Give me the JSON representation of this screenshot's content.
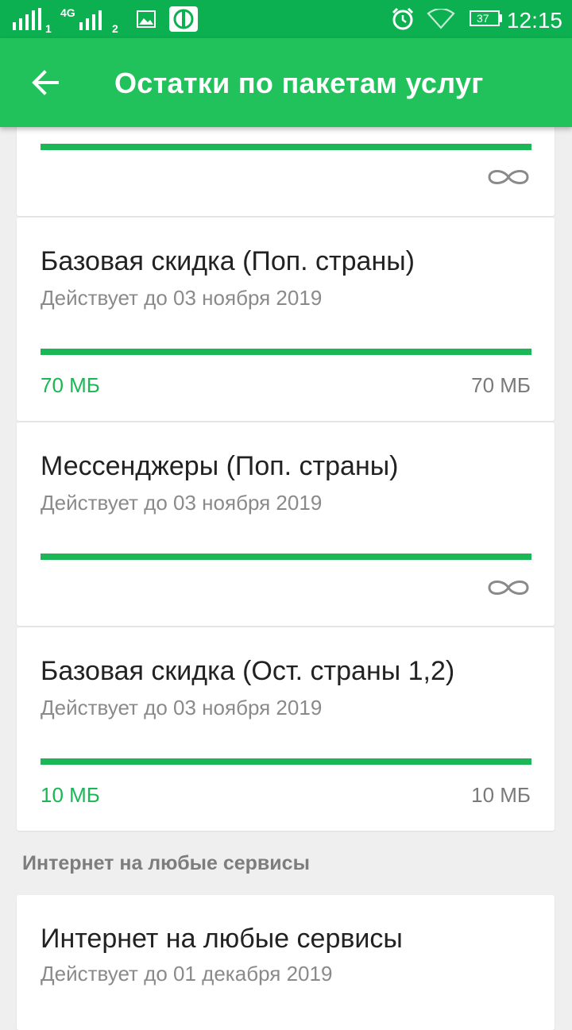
{
  "status_bar": {
    "sim1_label": "1",
    "sim2_network": "4G",
    "sim2_label": "2",
    "battery_level": "37",
    "time": "12:15",
    "icons": [
      "signal-icon",
      "signal-4g-icon",
      "gallery-icon",
      "operator-app-icon",
      "alarm-icon",
      "wifi-icon",
      "battery-icon"
    ]
  },
  "app_bar": {
    "back_icon": "arrow-left-icon",
    "title": "Остатки по пакетам услуг"
  },
  "packages": [
    {
      "title": "",
      "progress": 1.0,
      "limit": "unlimited"
    },
    {
      "title": "Базовая скидка (Поп. страны)",
      "valid_until": "Действует до 03 ноября 2019",
      "progress": 1.0,
      "remaining": "70 МБ",
      "total": "70 МБ"
    },
    {
      "title": "Мессенджеры (Поп. страны)",
      "valid_until": "Действует до 03 ноября 2019",
      "progress": 1.0,
      "limit": "unlimited"
    },
    {
      "title": "Базовая скидка (Ост. страны 1,2)",
      "valid_until": "Действует до 03 ноября 2019",
      "progress": 1.0,
      "remaining": "10 МБ",
      "total": "10 МБ"
    }
  ],
  "section": {
    "label": "Интернет на любые сервисы"
  },
  "section_packages": [
    {
      "title": "Интернет на любые сервисы",
      "valid_until": "Действует до 01 декабря 2019"
    }
  ],
  "colors": {
    "status_bar": "#0cb050",
    "app_bar": "#21c25b",
    "accent": "#1bb656",
    "background": "#efefef"
  }
}
